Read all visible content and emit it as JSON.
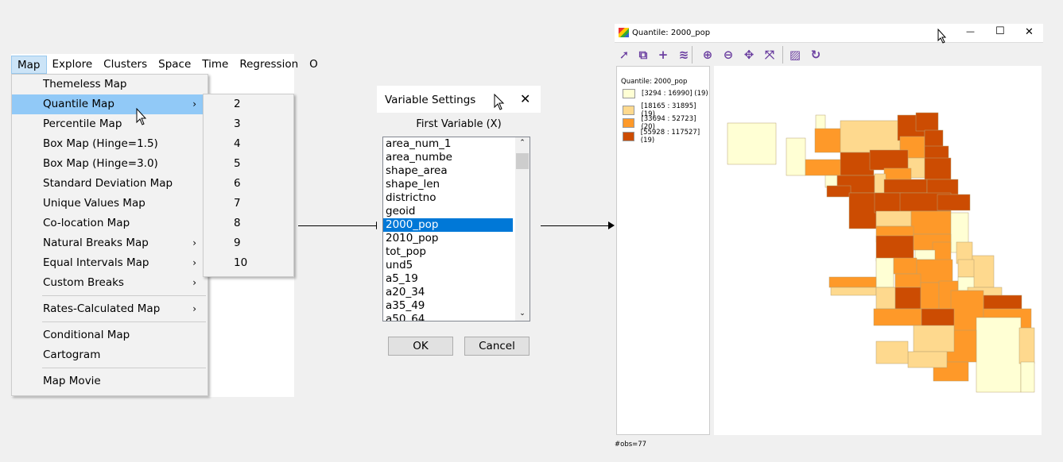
{
  "menubar": {
    "items": [
      "Map",
      "Explore",
      "Clusters",
      "Space",
      "Time",
      "Regression",
      "O"
    ]
  },
  "map_menu": {
    "items": [
      {
        "label": "Themeless Map",
        "submenu": false
      },
      {
        "label": "Quantile Map",
        "submenu": true,
        "highlighted": true
      },
      {
        "label": "Percentile Map",
        "submenu": false
      },
      {
        "label": "Box Map (Hinge=1.5)",
        "submenu": false
      },
      {
        "label": "Box Map (Hinge=3.0)",
        "submenu": false
      },
      {
        "label": "Standard Deviation Map",
        "submenu": false
      },
      {
        "label": "Unique Values Map",
        "submenu": false
      },
      {
        "label": "Co-location Map",
        "submenu": false
      },
      {
        "label": "Natural Breaks Map",
        "submenu": true
      },
      {
        "label": "Equal Intervals Map",
        "submenu": true
      },
      {
        "label": "Custom Breaks",
        "submenu": true
      },
      {
        "label": "Rates-Calculated Map",
        "submenu": true
      },
      {
        "label": "Conditional Map",
        "submenu": false
      },
      {
        "label": "Cartogram",
        "submenu": false
      },
      {
        "label": "Map Movie",
        "submenu": false
      }
    ],
    "chevron": "›"
  },
  "quantile_submenu": {
    "items": [
      "2",
      "3",
      "4",
      "5",
      "6",
      "7",
      "8",
      "9",
      "10"
    ]
  },
  "dialog": {
    "title": "Variable Settings",
    "close": "✕",
    "label": "First Variable (X)",
    "variables": [
      "area_num_1",
      "area_numbe",
      "shape_area",
      "shape_len",
      "districtno",
      "geoid",
      "2000_pop",
      "2010_pop",
      "tot_pop",
      "und5",
      "a5_19",
      "a20_34",
      "a35_49",
      "a50_64"
    ],
    "selected": "2000_pop",
    "ok": "OK",
    "cancel": "Cancel"
  },
  "map_window": {
    "title": "Quantile: 2000_pop",
    "minimize": "—",
    "maximize": "☐",
    "close": "✕",
    "toolbar": [
      "select-icon",
      "copy-icon",
      "add-icon",
      "layers-icon",
      "zoom-in-icon",
      "zoom-out-icon",
      "pan-icon",
      "fit-icon",
      "basemap-icon",
      "refresh-icon"
    ],
    "legend": {
      "title": "Quantile: 2000_pop",
      "classes": [
        {
          "label": "[3294 : 16990] (19)",
          "color": "#ffffd4"
        },
        {
          "label": "[18165 : 31895] (19)",
          "color": "#fed98e"
        },
        {
          "label": "[33694 : 52723] (20)",
          "color": "#fe9929"
        },
        {
          "label": "[55928 : 117527] (19)",
          "color": "#cc4c02"
        }
      ]
    },
    "status": "#obs=77"
  }
}
